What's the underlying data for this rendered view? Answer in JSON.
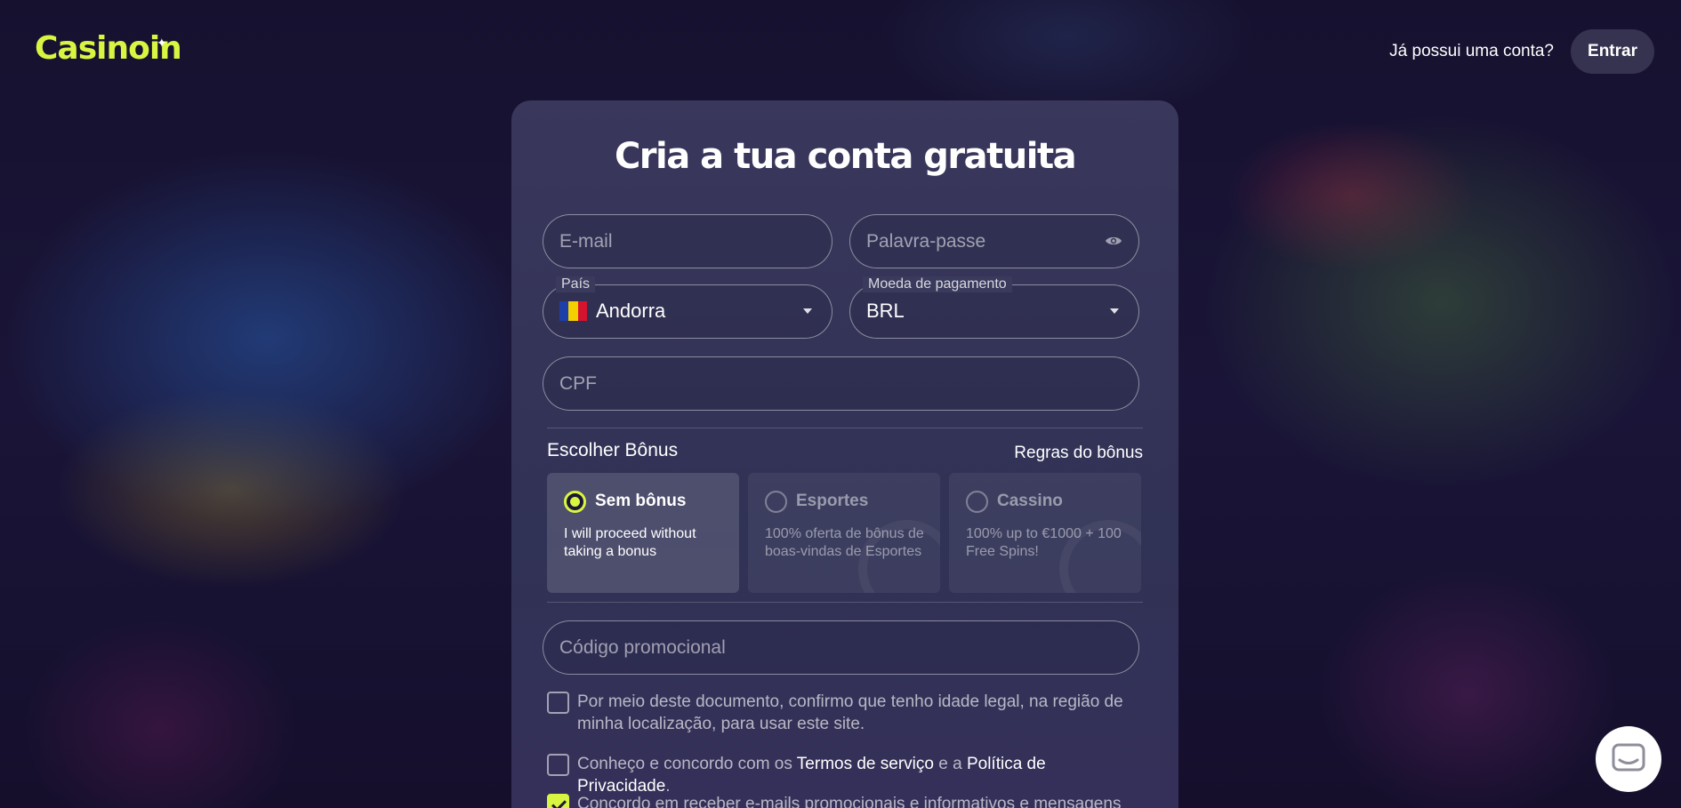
{
  "header": {
    "logo_text": "Casinoin",
    "logo_star": "✦",
    "has_account_text": "Já possui uma conta?",
    "login_label": "Entrar"
  },
  "form": {
    "title": "Cria a tua conta gratuita",
    "email_placeholder": "E-mail",
    "password_placeholder": "Palavra-passe",
    "country_label": "País",
    "country_value": "Andorra",
    "currency_label": "Moeda de pagamento",
    "currency_value": "BRL",
    "cpf_placeholder": "CPF",
    "bonus_heading": "Escolher Bônus",
    "bonus_rules_label": "Regras do bônus",
    "bonus_options": [
      {
        "name": "Sem bônus",
        "description": "I will proceed without taking a bonus",
        "selected": true
      },
      {
        "name": "Esportes",
        "description": "100% oferta de bônus de boas-vindas de Esportes",
        "selected": false
      },
      {
        "name": "Cassino",
        "description": "100% up to €1000 + 100 Free Spins!",
        "selected": false
      }
    ],
    "promo_placeholder": "Código promocional",
    "consents": [
      {
        "text": "Por meio deste documento, confirmo que tenho idade legal, na região de minha localização, para usar este site.",
        "checked": false
      },
      {
        "text_before": "Conheço e concordo com os ",
        "link1": "Termos de serviço",
        "text_middle": " e a ",
        "link2": "Política de Privacidade",
        "text_after": ".",
        "checked": false
      },
      {
        "text": "Concordo em receber e-mails promocionais e informativos e mensagens",
        "checked": true
      }
    ]
  },
  "colors": {
    "accent": "#d9f542",
    "background": "#140f2e",
    "card": "#3a3a5d"
  },
  "icons": {
    "password_toggle": "eye-icon",
    "dropdown": "caret-down-icon",
    "chat": "chat-icon"
  }
}
